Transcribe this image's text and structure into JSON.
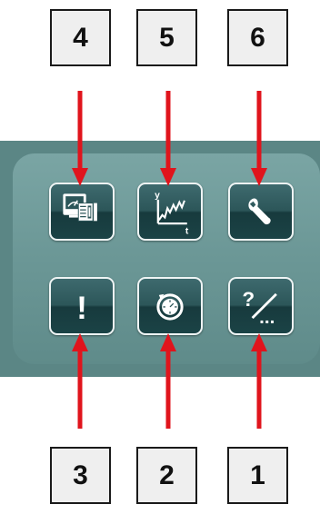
{
  "callouts": [
    {
      "id": "4",
      "label": "4"
    },
    {
      "id": "5",
      "label": "5"
    },
    {
      "id": "6",
      "label": "6"
    },
    {
      "id": "3",
      "label": "3"
    },
    {
      "id": "2",
      "label": "2"
    },
    {
      "id": "1",
      "label": "1"
    }
  ],
  "buttons": {
    "dashboard": {
      "icon": "display-document-icon"
    },
    "chart": {
      "icon": "trend-chart-icon",
      "y_label": "y",
      "t_label": "t"
    },
    "wrench": {
      "icon": "wrench-icon"
    },
    "alert": {
      "icon": "exclamation-icon",
      "glyph": "!"
    },
    "timer": {
      "icon": "stopwatch-icon"
    },
    "help": {
      "icon": "help-more-icon",
      "glyph": "?",
      "dots": "..."
    }
  },
  "colors": {
    "arrow": "#e0141c",
    "panel": "#6a9797",
    "tile": "#2c5659"
  }
}
